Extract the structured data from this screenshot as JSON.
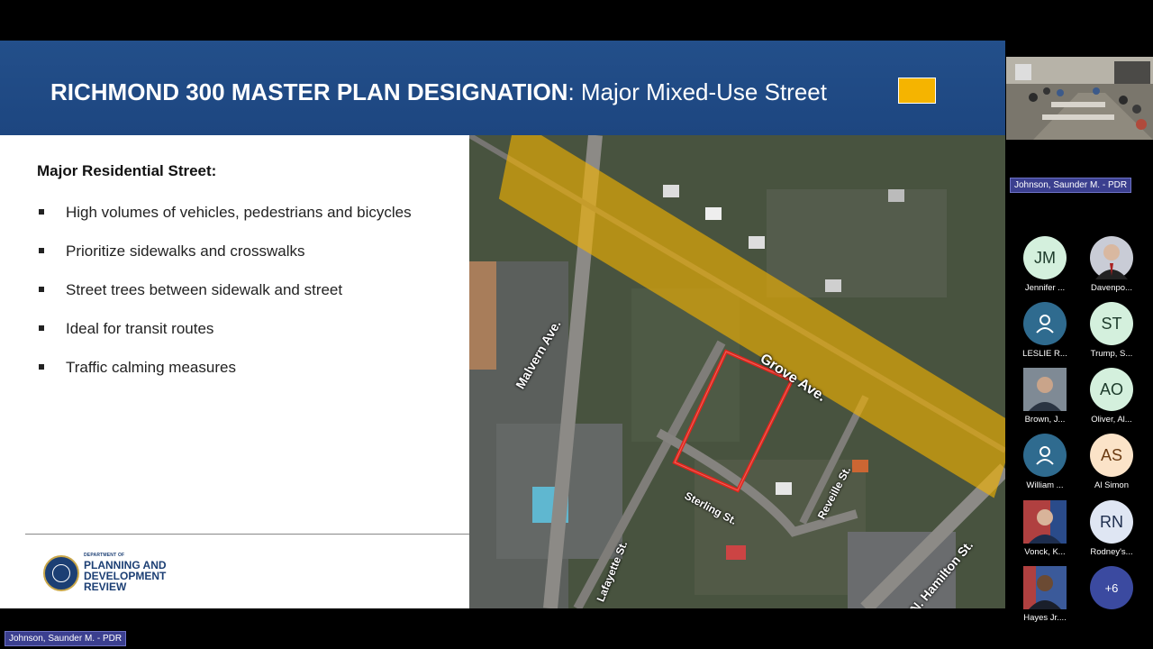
{
  "slide": {
    "title_bold": "RICHMOND 300 MASTER PLAN DESIGNATION",
    "title_rest": ": Major Mixed-Use Street",
    "legend_color": "#f5b400",
    "section_heading": "Major Residential Street:",
    "bullets": [
      "High volumes of vehicles, pedestrians and bicycles",
      "Prioritize sidewalks and crosswalks",
      "Street trees between sidewalk and street",
      "Ideal for transit routes",
      "Traffic calming measures"
    ],
    "footer": {
      "dept_line": "DEPARTMENT OF",
      "name": "PLANNING AND DEVELOPMENT REVIEW",
      "seal_icon": "city-seal-icon"
    },
    "map": {
      "streets": {
        "grove": "Grove Ave.",
        "malvern": "Malvern Ave.",
        "sterling": "Sterling St.",
        "reveille": "Reveille St.",
        "lafayette": "Lafayette St.",
        "hamilton": "N. Hamilton St."
      },
      "highlight_color": "#f5b400",
      "parcel_outline_color": "#e3241b"
    }
  },
  "meeting": {
    "active_speaker": "Johnson, Saunder M. - PDR",
    "bottom_label": "Johnson, Saunder M. - PDR",
    "participants": [
      {
        "initials": "JM",
        "name": "Jennifer ...",
        "color": "#d4f0dd"
      },
      {
        "initials": "",
        "name": "Davenpo...",
        "color": "#c9ccd6",
        "photo": true
      },
      {
        "initials": "",
        "name": "LESLIE R...",
        "color": "#2f6b8f",
        "icon": "user-icon"
      },
      {
        "initials": "ST",
        "name": "Trump, S...",
        "color": "#d4f0dd"
      },
      {
        "initials": "",
        "name": "Brown, J...",
        "color": "#8a8f96",
        "photo": true
      },
      {
        "initials": "AO",
        "name": "Oliver, Al...",
        "color": "#d4f0dd"
      },
      {
        "initials": "",
        "name": "William ...",
        "color": "#2f6b8f",
        "icon": "user-icon"
      },
      {
        "initials": "AS",
        "name": "Al Simon",
        "color": "#fbe3c8"
      },
      {
        "initials": "",
        "name": "Vonck, K...",
        "color": "#a8a4a0",
        "photo": true
      },
      {
        "initials": "RN",
        "name": "Rodney's...",
        "color": "#dfe6f3"
      },
      {
        "initials": "",
        "name": "Hayes Jr....",
        "color": "#9aa0a8",
        "photo": true
      }
    ],
    "more_count": "+6"
  }
}
